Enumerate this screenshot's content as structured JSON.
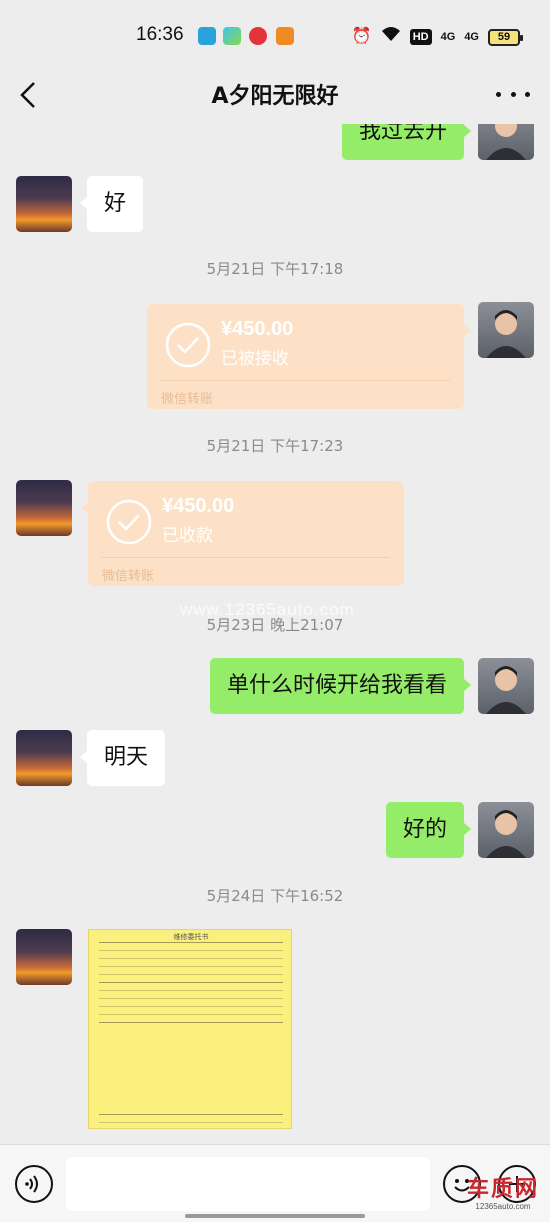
{
  "status_bar": {
    "time": "16:36",
    "hd_label": "HD",
    "signal1": "4G",
    "signal2": "4G",
    "battery": "59",
    "icons": [
      "telegram-icon",
      "play-icon",
      "video-icon",
      "uc-browser-icon",
      "alarm-icon",
      "wifi-icon"
    ]
  },
  "header": {
    "title": "A夕阳无限好"
  },
  "messages": {
    "m0": "我过去开",
    "m1": "好",
    "ts1": "5月21日 下午17:18",
    "transfer_out": {
      "amount": "¥450.00",
      "status": "已被接收",
      "source": "微信转账"
    },
    "ts2": "5月21日 下午17:23",
    "transfer_in": {
      "amount": "¥450.00",
      "status": "已收款",
      "source": "微信转账"
    },
    "watermark": "www.12365auto.com",
    "ts3": "5月23日 晚上21:07",
    "m2": "单什么时候开给我看看",
    "m3": "明天",
    "m4": "好的",
    "ts4": "5月24日 下午16:52",
    "doc_title": "维修委托书"
  },
  "colors": {
    "bg": "#ededed",
    "bubble_out": "#95ec69",
    "bubble_in": "#ffffff",
    "transfer": "#fde1c7",
    "doc": "#fbf07e"
  },
  "input_bar": {
    "value": "",
    "placeholder": ""
  },
  "logo": {
    "text": "车质网",
    "url": "12365auto.com"
  }
}
